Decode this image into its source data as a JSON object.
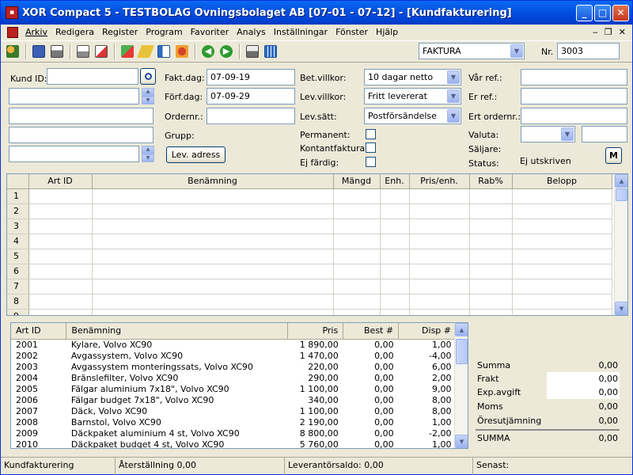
{
  "window": {
    "title": "XOR Compact 5 - TESTBOLAG Övningsbolaget AB [07-01 - 07-12] - [Kundfakturering]",
    "minimize": "_",
    "maximize": "□",
    "close": "✕"
  },
  "menu": {
    "items": [
      "Arkiv",
      "Redigera",
      "Register",
      "Program",
      "Favoriter",
      "Analys",
      "Inställningar",
      "Fönster",
      "Hjälp"
    ],
    "mdi_min": "‒",
    "mdi_restore": "❐",
    "mdi_close": "✕"
  },
  "toolbar": {
    "icons": [
      "users-icon",
      "save-icon",
      "print-icon",
      "print-preview-icon",
      "edit-icon",
      "copy-icon",
      "eraser-icon",
      "card-icon",
      "invoice-icon",
      "back-icon",
      "forward-icon",
      "printer-icon",
      "calendar-icon"
    ],
    "doc_type": "FAKTURA",
    "nr_label": "Nr.",
    "nr_value": "3003"
  },
  "form": {
    "kund_id_label": "Kund ID:",
    "kund_id_value": "",
    "fakt_dag_label": "Fakt.dag:",
    "fakt_dag_value": "07-09-19",
    "forf_dag_label": "Förf.dag:",
    "forf_dag_value": "07-09-29",
    "ordernr_label": "Ordernr.:",
    "ordernr_value": "",
    "grupp_label": "Grupp:",
    "lev_adress_button": "Lev. adress",
    "bet_villkor_label": "Bet.villkor:",
    "bet_villkor_value": "10 dagar netto",
    "lev_villkor_label": "Lev.villkor:",
    "lev_villkor_value": "Fritt levererat",
    "lev_satt_label": "Lev.sätt:",
    "lev_satt_value": "Postförsändelse",
    "permanent_label": "Permanent:",
    "kontantfaktura_label": "Kontantfaktura:",
    "ej_fardig_label": "Ej färdig:",
    "var_ref_label": "Vår ref.:",
    "er_ref_label": "Er ref.:",
    "ert_ordernr_label": "Ert ordernr.:",
    "valuta_label": "Valuta:",
    "saljare_label": "Säljare:",
    "status_label": "Status:",
    "status_value": "Ej utskriven",
    "m_button": "M"
  },
  "grid": {
    "columns": [
      "Art ID",
      "Benämning",
      "Mängd",
      "Enh.",
      "Pris/enh.",
      "Rab%",
      "Belopp"
    ],
    "row_numbers": [
      "1",
      "2",
      "3",
      "4",
      "5",
      "6",
      "7",
      "8",
      "9"
    ]
  },
  "products": {
    "columns": [
      "Art ID",
      "Benämning",
      "Pris",
      "Best #",
      "Disp #"
    ],
    "rows": [
      [
        "2001",
        "Kylare, Volvo XC90",
        "1 890,00",
        "0,00",
        "1,00"
      ],
      [
        "2002",
        "Avgassystem, Volvo XC90",
        "1 470,00",
        "0,00",
        "-4,00"
      ],
      [
        "2003",
        "Avgassystem monteringssats, Volvo XC90",
        "220,00",
        "0,00",
        "6,00"
      ],
      [
        "2004",
        "Bränslefilter, Volvo XC90",
        "290,00",
        "0,00",
        "2,00"
      ],
      [
        "2005",
        "Fälgar aluminium 7x18\", Volvo XC90",
        "1 100,00",
        "0,00",
        "9,00"
      ],
      [
        "2006",
        "Fälgar budget 7x18\", Volvo XC90",
        "340,00",
        "0,00",
        "8,00"
      ],
      [
        "2007",
        "Däck, Volvo XC90",
        "1 100,00",
        "0,00",
        "8,00"
      ],
      [
        "2008",
        "Barnstol, Volvo XC90",
        "2 190,00",
        "0,00",
        "1,00"
      ],
      [
        "2009",
        "Däckpaket aluminium 4 st, Volvo XC90",
        "8 800,00",
        "0,00",
        "-2,00"
      ],
      [
        "2010",
        "Däckpaket budget 4 st, Volvo XC90",
        "5 760,00",
        "0,00",
        "1,00"
      ]
    ]
  },
  "summary": {
    "summa_label": "Summa",
    "summa_value": "0,00",
    "frakt_label": "Frakt",
    "frakt_value": "0,00",
    "exp_label": "Exp.avgift",
    "exp_value": "0,00",
    "moms_label": "Moms",
    "moms_value": "0,00",
    "ores_label": "Öresutjämning",
    "ores_value": "0,00",
    "total_label": "SUMMA",
    "total_value": "0,00"
  },
  "statusbar": {
    "module": "Kundfakturering",
    "aterstallning": "Återställning  0,00",
    "leverantorsaldo": "Leverantörsaldo:  0,00",
    "senast": "Senast:"
  }
}
